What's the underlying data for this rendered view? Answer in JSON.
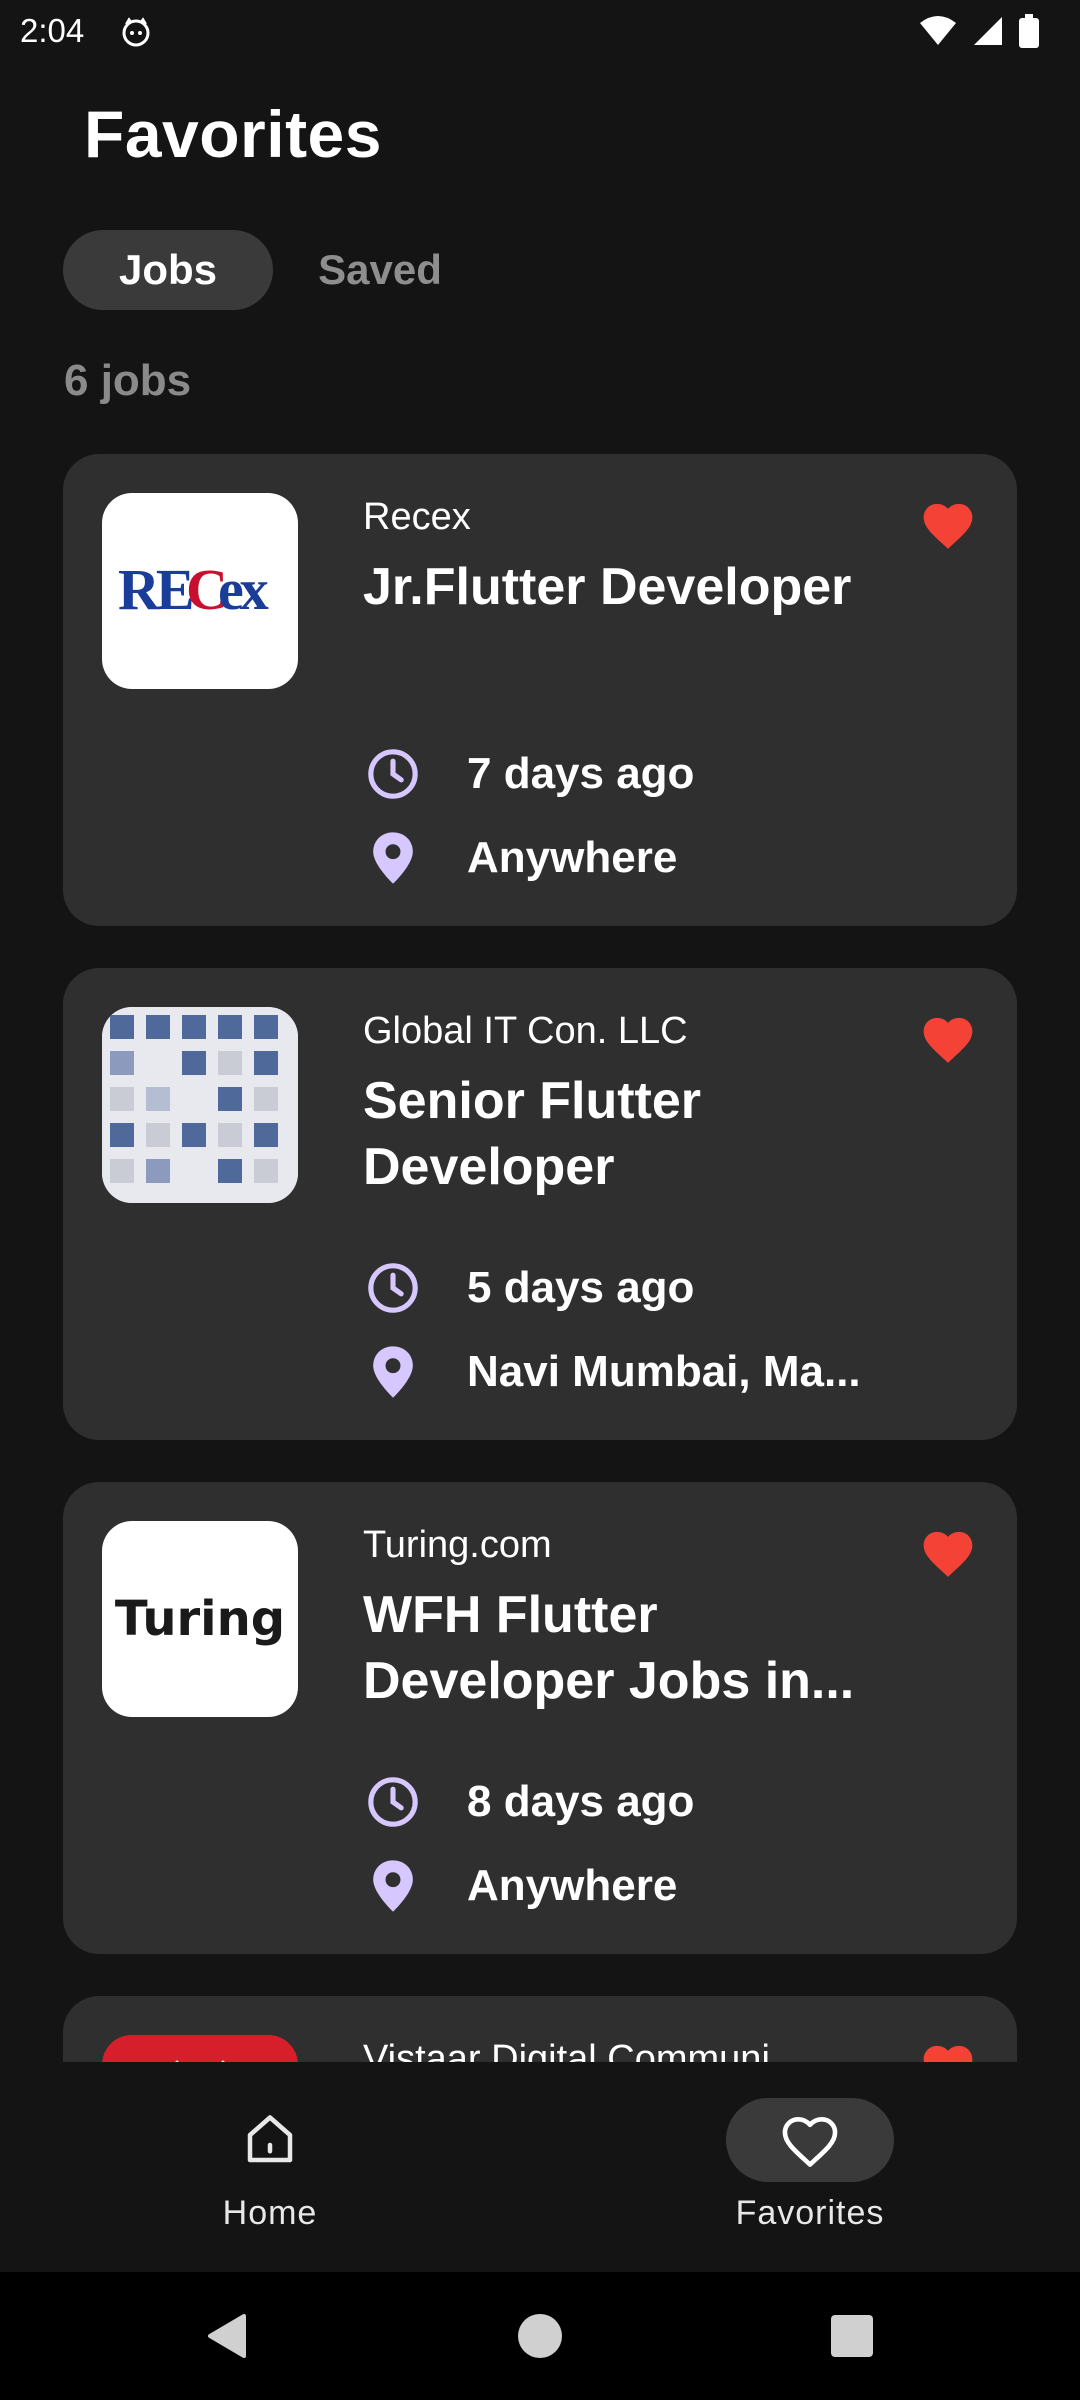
{
  "status_bar": {
    "time": "2:04"
  },
  "header": {
    "title": "Favorites"
  },
  "tabs": [
    {
      "label": "Jobs",
      "active": true
    },
    {
      "label": "Saved",
      "active": false
    }
  ],
  "jobs_count": "6 jobs",
  "jobs": [
    {
      "company": "Recex",
      "title": "Jr.Flutter Developer",
      "posted": "7 days ago",
      "location": "Anywhere",
      "logo": "recex-logo",
      "favorited": true
    },
    {
      "company": "Global IT Con. LLC",
      "title": "Senior Flutter Developer",
      "posted": "5 days ago",
      "location": "Navi Mumbai, Ma...",
      "logo": "grid-logo",
      "favorited": true
    },
    {
      "company": "Turing.com",
      "title": "WFH Flutter Developer Jobs in...",
      "posted": "8 days ago",
      "location": "Anywhere",
      "logo": "turing-logo",
      "favorited": true
    },
    {
      "company": "Vistaar Digital Communi...",
      "title": "",
      "posted": "",
      "location": "",
      "logo": "red-logo",
      "favorited": true
    }
  ],
  "bottom_nav": [
    {
      "label": "Home",
      "icon": "home-icon",
      "active": false
    },
    {
      "label": "Favorites",
      "icon": "heart-outline-icon",
      "active": true
    }
  ],
  "colors": {
    "background": "#141414",
    "card": "#2f2f2f",
    "accent_heart": "#f44336",
    "icon_lavender": "#d7c7ff"
  }
}
